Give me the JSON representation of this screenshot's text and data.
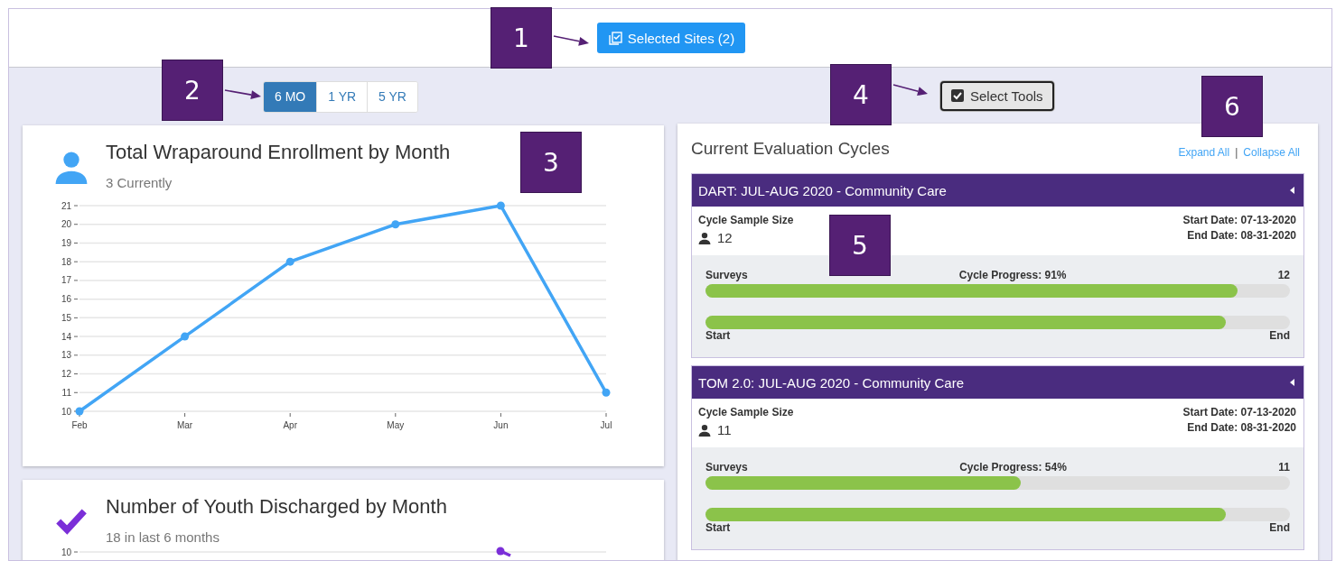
{
  "top_bar": {
    "button": "Selected Sites (2)"
  },
  "range_tabs": [
    {
      "label": "6 MO",
      "selected": true
    },
    {
      "label": "1 YR",
      "selected": false
    },
    {
      "label": "5 YR",
      "selected": false
    }
  ],
  "tools_button": {
    "label": "Select Tools"
  },
  "enrollment_card": {
    "title": "Total Wraparound Enrollment by Month",
    "subtitle": "3 Currently",
    "chart_data": {
      "type": "line",
      "grid": true,
      "categories": [
        "Feb",
        "Mar",
        "Apr",
        "May",
        "Jun",
        "Jul"
      ],
      "yticks": [
        10,
        11,
        12,
        13,
        14,
        15,
        16,
        17,
        18,
        19,
        20,
        21
      ],
      "ylim": [
        10,
        21
      ],
      "series": [
        {
          "color": "#42a5f5",
          "marker": true,
          "values": [
            10,
            14,
            18,
            20,
            21,
            11
          ]
        }
      ]
    }
  },
  "discharge_card": {
    "title": "Number of Youth Discharged by Month",
    "subtitle": "18 in last 6 months",
    "visible_tick": "10"
  },
  "cycles_panel": {
    "title": "Current Evaluation Cycles",
    "expand_link": "Expand All",
    "separator": "|",
    "collapse_link": "Collapse All",
    "cycles": [
      {
        "title": "DART: JUL-AUG 2020 - Community Care",
        "sample_label": "Cycle Sample Size",
        "sample_size": "12",
        "start_date": "Start Date: 07-13-2020",
        "end_date": "End Date: 08-31-2020",
        "surveys_label": "Surveys",
        "progress_label": "Cycle Progress: 91%",
        "survey_count": "12",
        "survey_bar": {
          "level": 0.91
        },
        "time_bar": {
          "level": 0.89
        },
        "start_label": "Start",
        "end_label": "End"
      },
      {
        "title": "TOM 2.0: JUL-AUG 2020 - Community Care",
        "sample_label": "Cycle Sample Size",
        "sample_size": "11",
        "start_date": "Start Date: 07-13-2020",
        "end_date": "End Date: 08-31-2020",
        "surveys_label": "Surveys",
        "progress_label": "Cycle Progress: 54%",
        "survey_count": "11",
        "survey_bar": {
          "level": 0.54
        },
        "time_bar": {
          "level": 0.89
        },
        "start_label": "Start",
        "end_label": "End"
      }
    ]
  },
  "callouts": [
    {
      "label": "1"
    },
    {
      "label": "2"
    },
    {
      "label": "3"
    },
    {
      "label": "4"
    },
    {
      "label": "5"
    },
    {
      "label": "6"
    }
  ]
}
